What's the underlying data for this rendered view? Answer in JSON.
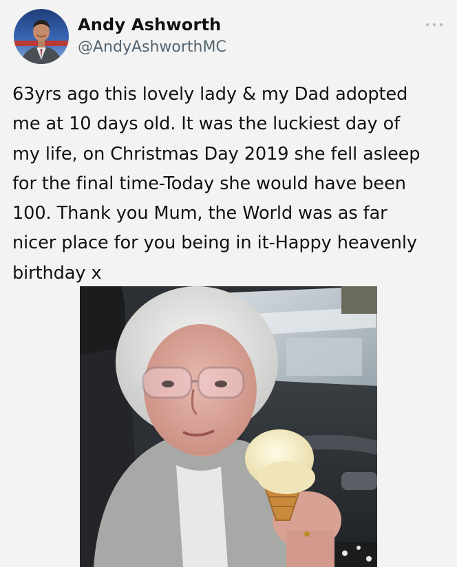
{
  "tweet": {
    "author_name": "Andy Ashworth",
    "author_handle": "@AndyAshworthMC",
    "text": "63yrs ago this lovely lady & my Dad adopted\nme at 10 days old. It was the luckiest day of\nmy life, on Christmas Day 2019 she fell asleep\nfor the final time-Today she would have been\n100. Thank you Mum, the World was as far\nnicer place for you being in it-Happy heavenly\nbirthday x"
  },
  "icons": {
    "more": "more-options-icon",
    "avatar": "profile-avatar"
  },
  "colors": {
    "background": "#f3f3f3",
    "text": "#111111",
    "handle": "#536471",
    "more_dots": "#b8c0c6"
  }
}
